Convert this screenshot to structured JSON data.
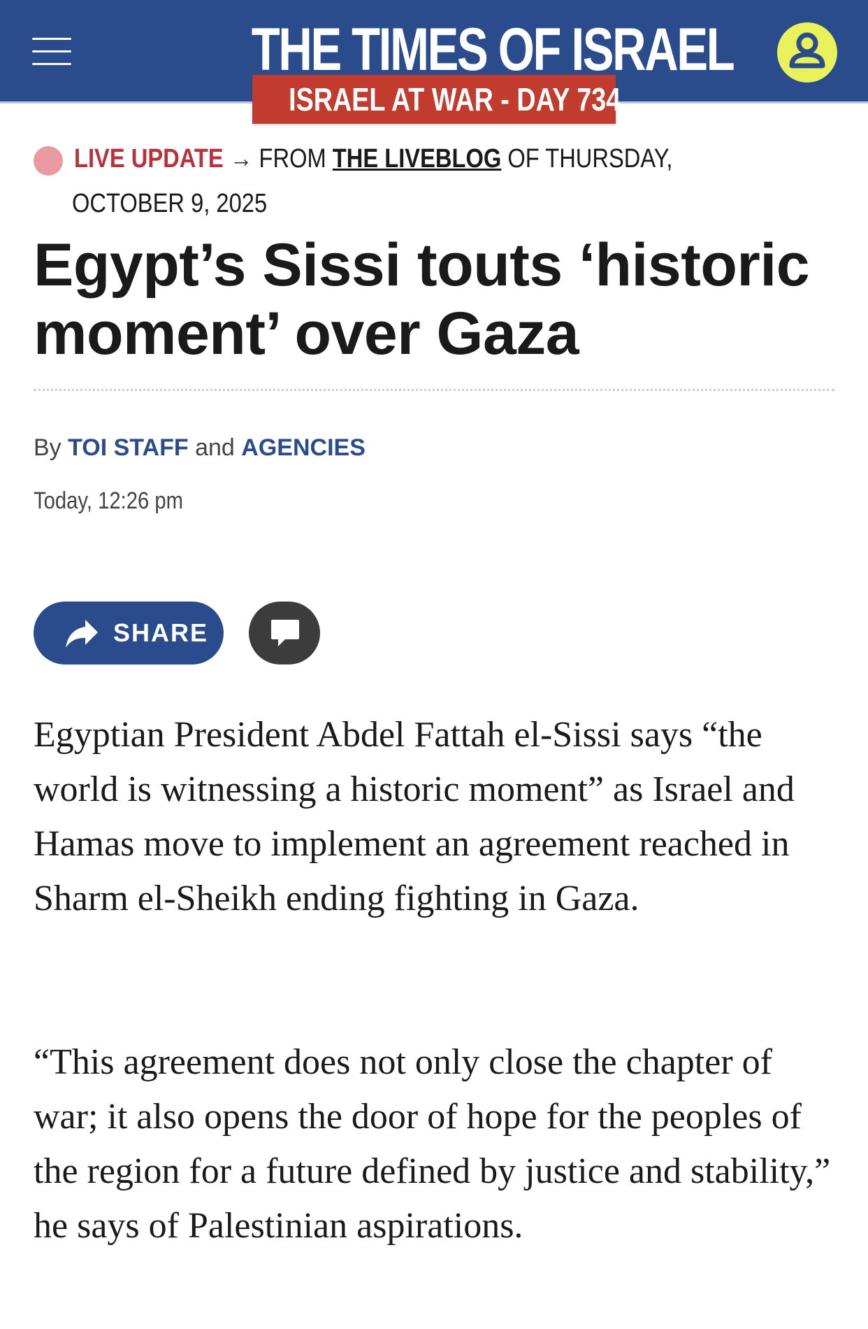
{
  "header": {
    "logo_text": "THE TIMES OF ISRAEL",
    "banner": "ISRAEL AT WAR - DAY 734",
    "menu_icon": "hamburger-menu-icon",
    "user_icon": "user-account-icon",
    "colors": {
      "header_bg": "#2b4c8c",
      "banner_bg": "#c23b2f",
      "user_bg": "#e9f25a"
    }
  },
  "live": {
    "label": "LIVE UPDATE",
    "arrow": "→",
    "from": "FROM",
    "liveblog_link": "THE LIVEBLOG",
    "of_day": "OF THURSDAY,",
    "date": "OCTOBER 9, 2025"
  },
  "article": {
    "headline": "Egypt’s Sissi touts ‘historic moment’ over Gaza",
    "byline": {
      "by": "By",
      "author1": "TOI STAFF",
      "and": "and",
      "author2": "AGENCIES"
    },
    "timestamp": "Today, 12:26 pm",
    "share_label": "SHARE",
    "paragraphs": [
      "Egyptian President Abdel Fattah el-Sissi says “the world is witnessing a historic moment” as Israel and Hamas move to implement an agreement reached in Sharm el-Sheikh ending fighting in Gaza.",
      "“This agreement does not only close the chapter of war; it also opens the door of hope for the peoples of the region for a future defined by justice and stability,” he says of Palestinian aspirations."
    ]
  }
}
